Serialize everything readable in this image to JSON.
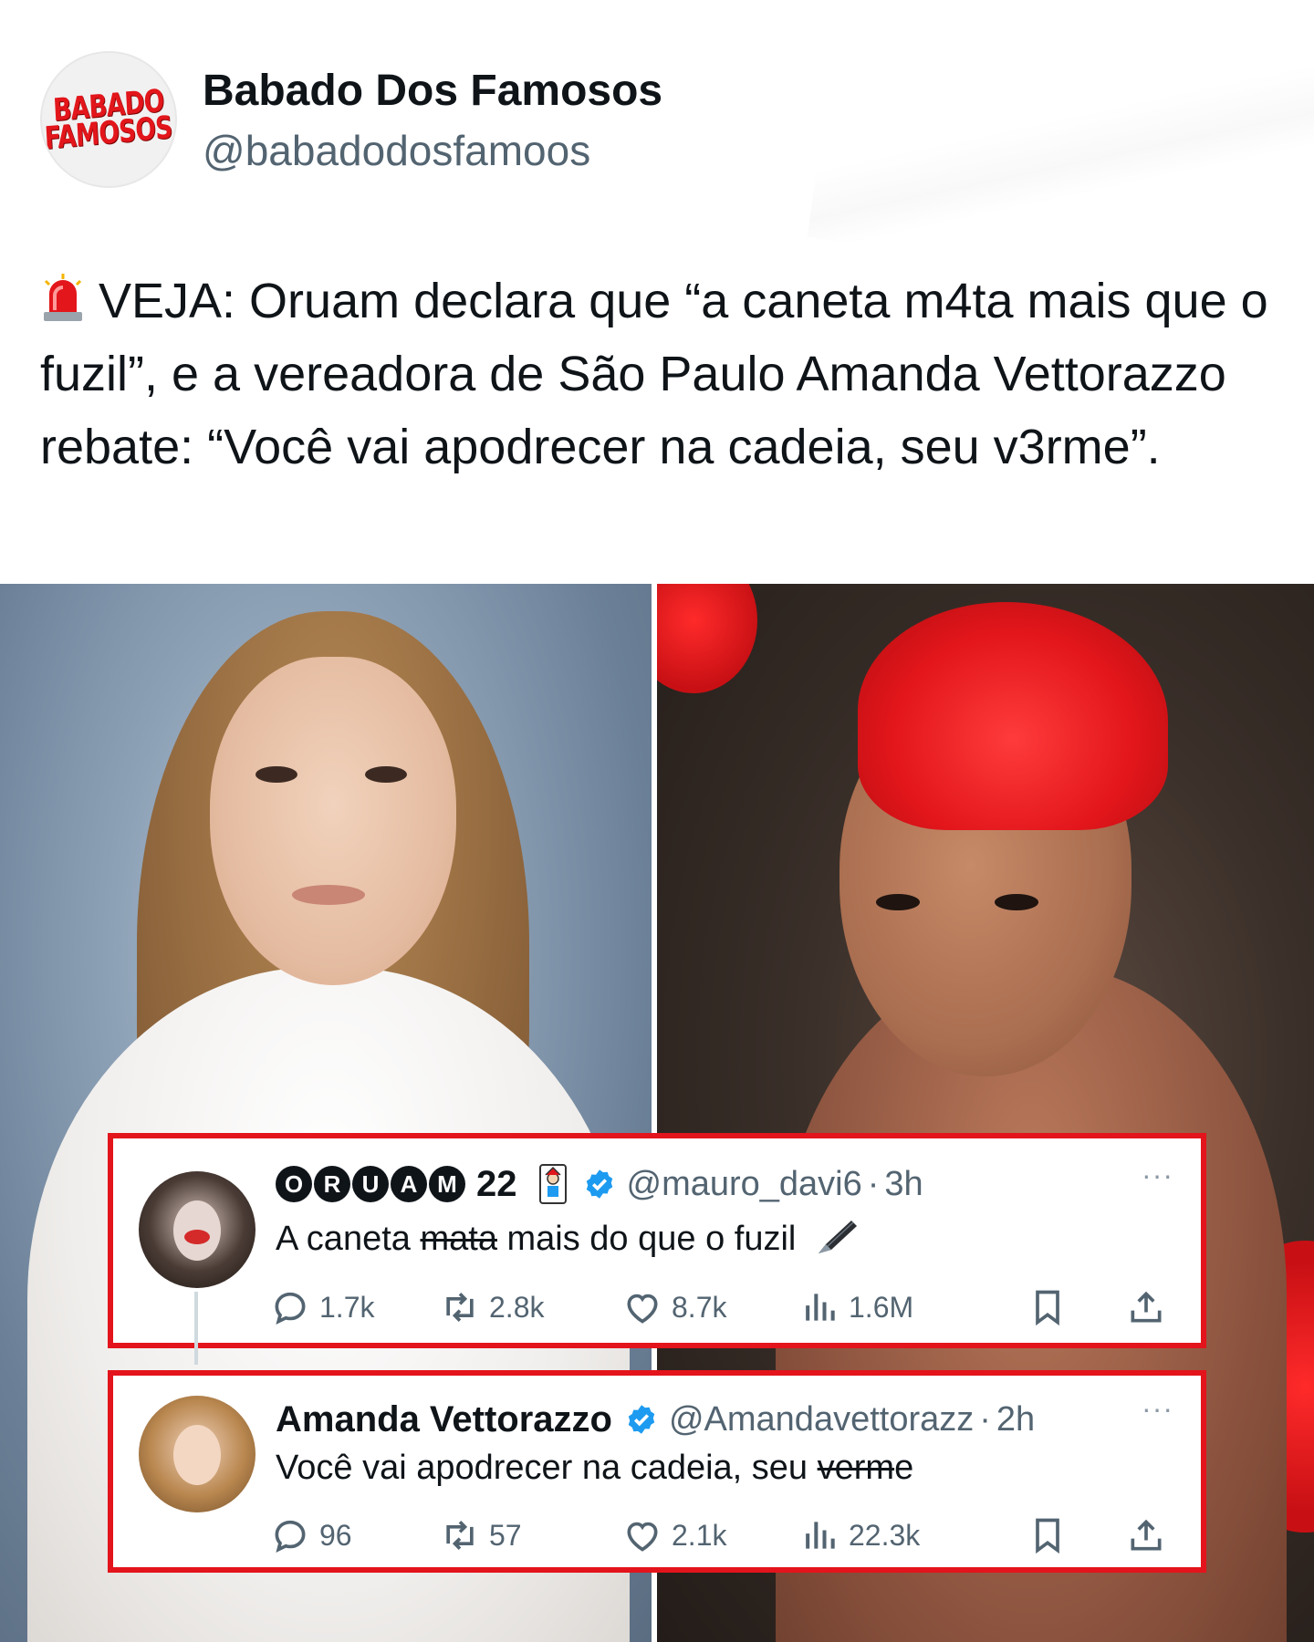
{
  "post": {
    "author_name": "Babado Dos Famosos",
    "author_handle": "@babadodosfamoos",
    "avatar_logo_line1": "BABADO",
    "avatar_logo_line2": "FAMOSOS",
    "text": "VEJA: Oruam declara que “a caneta m4ta mais que o fuzil”, e a vereadora de São Paulo Amanda Vettorazzo rebate: “Você vai apodrecer na cadeia, seu v3rme”.",
    "emoji_icon": "police-siren-icon"
  },
  "tweets": [
    {
      "name_letters": [
        "O",
        "R",
        "U",
        "A",
        "M"
      ],
      "name_suffix": "22",
      "handle": "@mauro_davi6",
      "dot": "·",
      "time": "3h",
      "more": "···",
      "text_before": "A caneta ",
      "text_struck": "mata",
      "text_after": " mais do que o fuzil",
      "replies": "1.7k",
      "retweets": "2.8k",
      "likes": "8.7k",
      "views": "1.6M"
    },
    {
      "name": "Amanda Vettorazzo",
      "handle": "@Amandavettorazz",
      "dot": "·",
      "time": "2h",
      "more": "···",
      "text_before": "Você vai apodrecer na cadeia, seu ",
      "text_struck": "verm",
      "text_after": "e",
      "replies": "96",
      "retweets": "57",
      "likes": "2.1k",
      "views": "22.3k"
    }
  ],
  "colors": {
    "highlight_border": "#e3141b",
    "verified_blue": "#1d9bf0",
    "text_secondary": "#536471",
    "brand_red": "#e2161b"
  }
}
